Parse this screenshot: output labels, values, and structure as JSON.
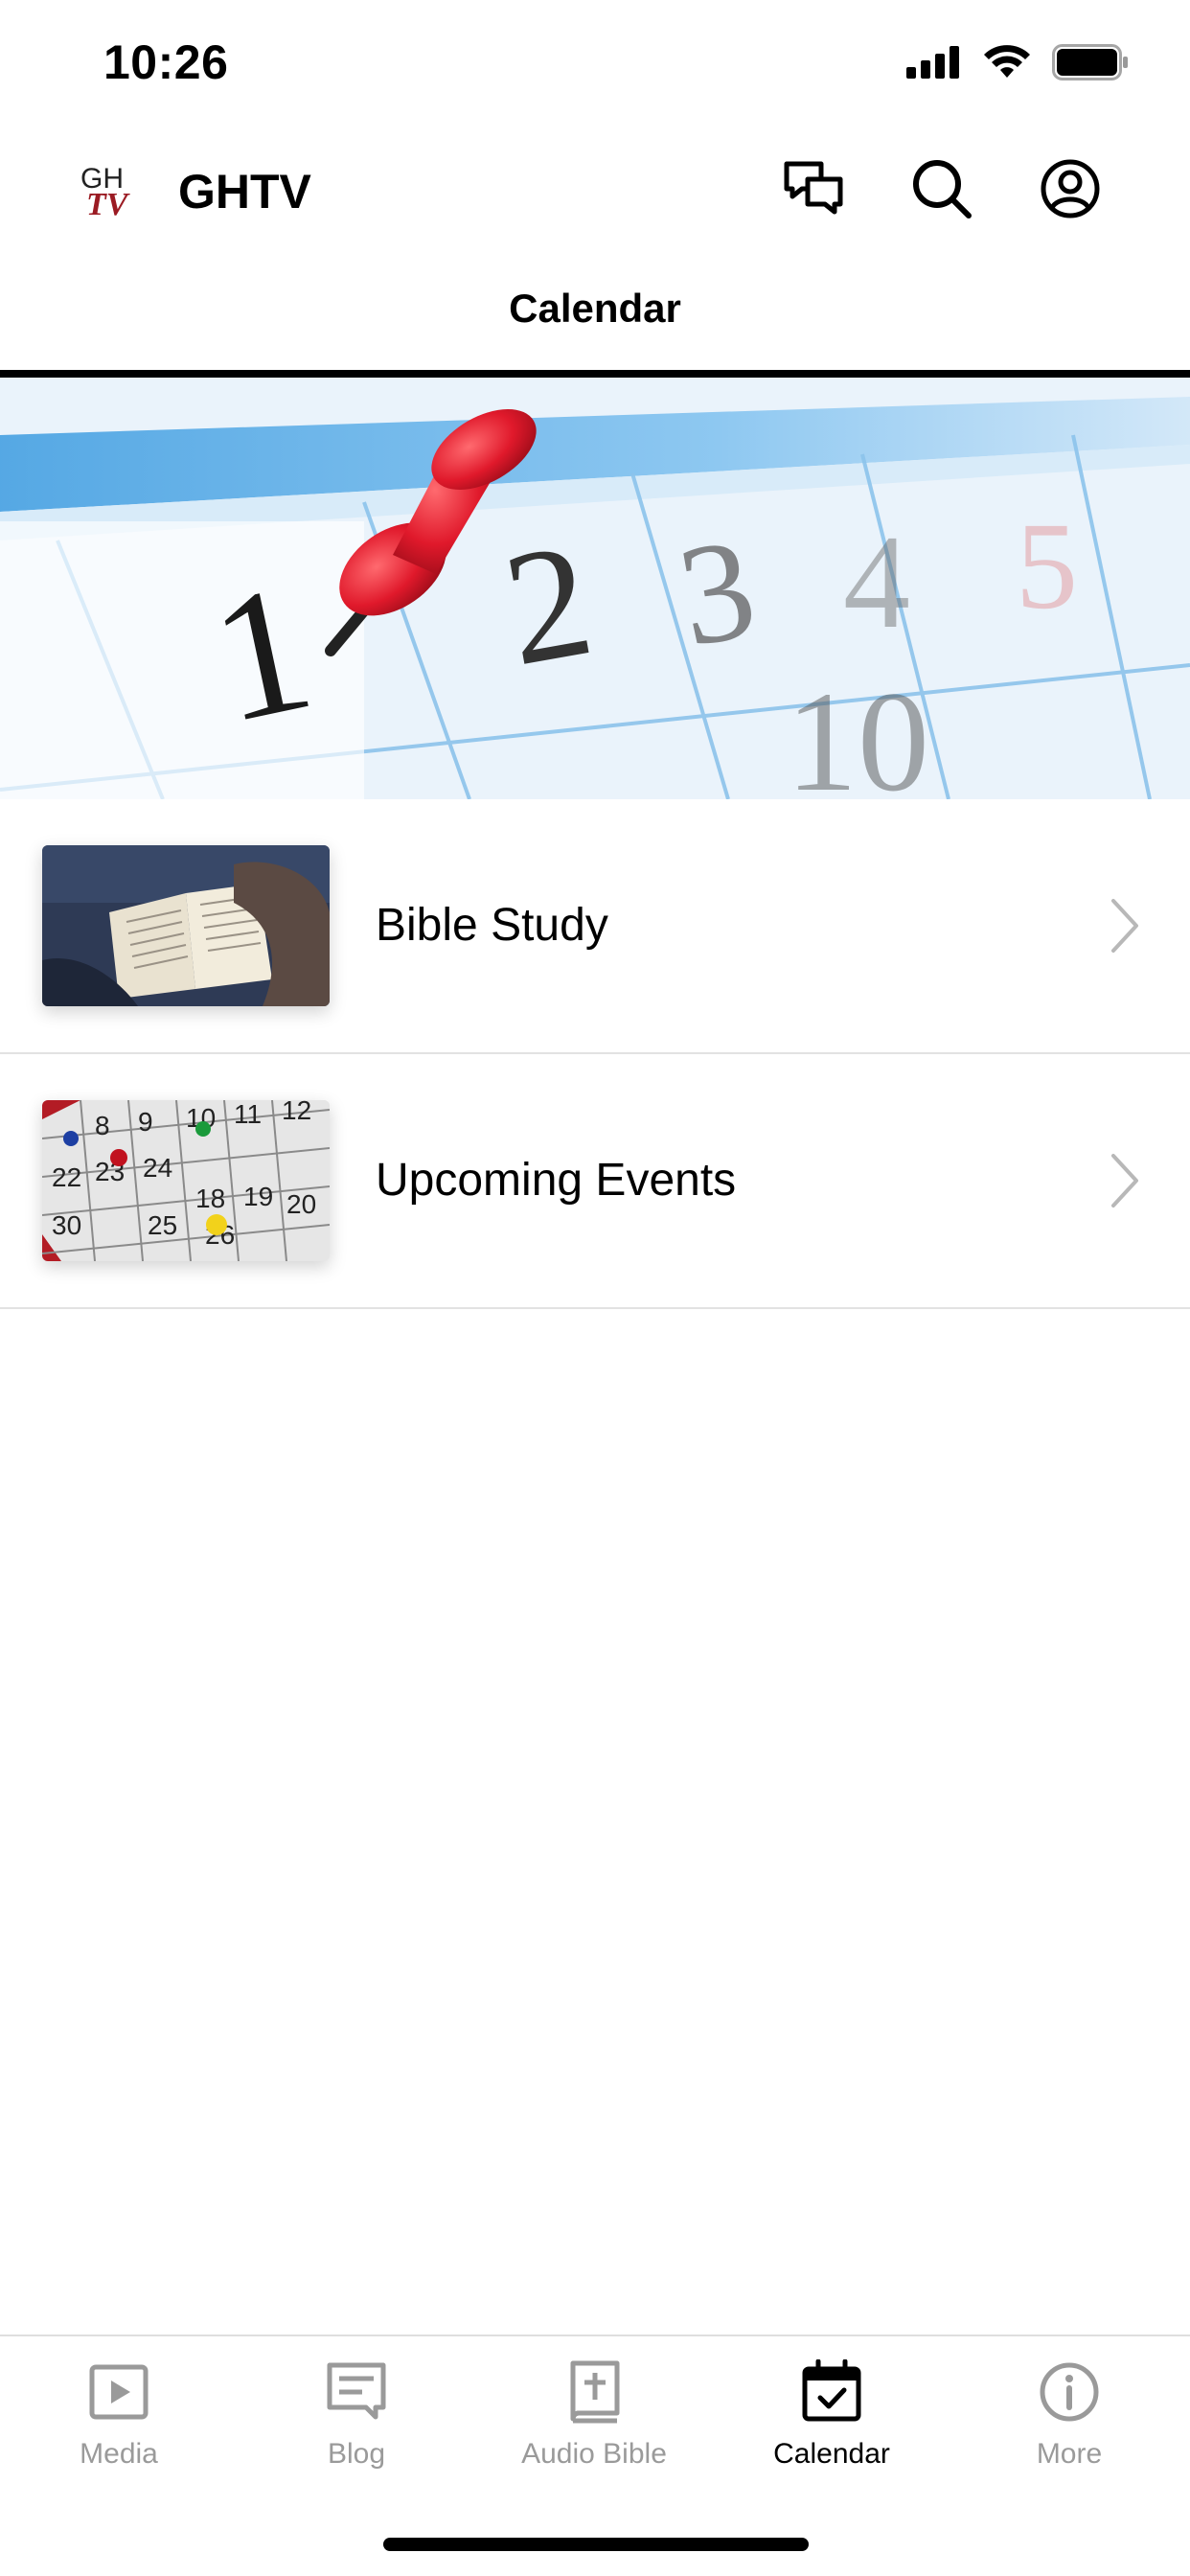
{
  "status_bar": {
    "time": "10:26",
    "icons": [
      "cellular-signal-icon",
      "wifi-icon",
      "battery-icon"
    ]
  },
  "header": {
    "logo_icon": "ghtv-logo-icon",
    "title": "GHTV",
    "actions": [
      "chat-icon",
      "search-icon",
      "account-icon"
    ]
  },
  "page": {
    "title": "Calendar",
    "hero_image": "calendar-pushpin-photo"
  },
  "list": {
    "items": [
      {
        "label": "Bible Study",
        "thumbnail": "open-bible-photo",
        "chevron": "chevron-right-icon"
      },
      {
        "label": "Upcoming Events",
        "thumbnail": "calendar-pins-photo",
        "chevron": "chevron-right-icon"
      }
    ]
  },
  "tab_bar": {
    "tabs": [
      {
        "label": "Media",
        "icon": "play-icon",
        "active": false
      },
      {
        "label": "Blog",
        "icon": "blog-icon",
        "active": false
      },
      {
        "label": "Audio Bible",
        "icon": "bible-icon",
        "active": false
      },
      {
        "label": "Calendar",
        "icon": "calendar-icon",
        "active": true
      },
      {
        "label": "More",
        "icon": "info-icon",
        "active": false
      }
    ]
  },
  "colors": {
    "accent": "#000000",
    "inactive_tab": "#9a9a9a",
    "divider": "#e2e2e2",
    "pin_red": "#e0192b"
  }
}
